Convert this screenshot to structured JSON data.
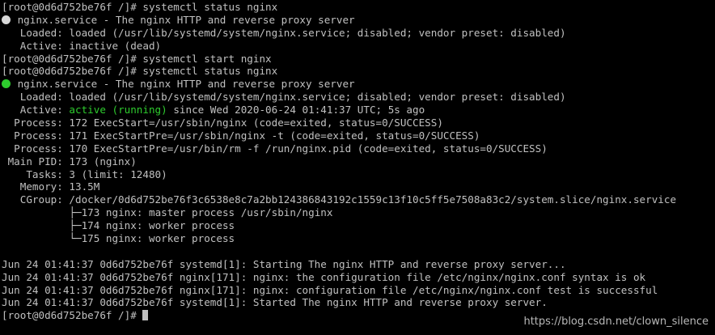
{
  "colors": {
    "background": "#000000",
    "text": "#c0c0c0",
    "active_green": "#2ecc2e",
    "inactive_dot": "#d8d8d8"
  },
  "lines": {
    "l0": "[root@0d6d752be76f /]# systemctl status nginx",
    "l1": "nginx.service - The nginx HTTP and reverse proxy server",
    "l2": "   Loaded: loaded (/usr/lib/systemd/system/nginx.service; disabled; vendor preset: disabled)",
    "l3": "   Active: inactive (dead)",
    "l4": "[root@0d6d752be76f /]# systemctl start nginx",
    "l5": "[root@0d6d752be76f /]# systemctl status nginx",
    "l6": "nginx.service - The nginx HTTP and reverse proxy server",
    "l7": "   Loaded: loaded (/usr/lib/systemd/system/nginx.service; disabled; vendor preset: disabled)",
    "l8_prefix": "   Active: ",
    "l8_status": "active (running)",
    "l8_suffix": " since Wed 2020-06-24 01:41:37 UTC; 5s ago",
    "l9": "  Process: 172 ExecStart=/usr/sbin/nginx (code=exited, status=0/SUCCESS)",
    "l10": "  Process: 171 ExecStartPre=/usr/sbin/nginx -t (code=exited, status=0/SUCCESS)",
    "l11": "  Process: 170 ExecStartPre=/usr/bin/rm -f /run/nginx.pid (code=exited, status=0/SUCCESS)",
    "l12": " Main PID: 173 (nginx)",
    "l13": "    Tasks: 3 (limit: 12480)",
    "l14": "   Memory: 13.5M",
    "l15": "   CGroup: /docker/0d6d752be76f3c6538e8c7a2bb124386843192c1559c13f10c5ff5e7508a83c2/system.slice/nginx.service",
    "l16_branch": "           ├─",
    "l16_text": "173 nginx: master process /usr/sbin/nginx",
    "l17_branch": "           ├─",
    "l17_text": "174 nginx: worker process",
    "l18_branch": "           └─",
    "l18_text": "175 nginx: worker process",
    "l19": "",
    "l20": "Jun 24 01:41:37 0d6d752be76f systemd[1]: Starting The nginx HTTP and reverse proxy server...",
    "l21": "Jun 24 01:41:37 0d6d752be76f nginx[171]: nginx: the configuration file /etc/nginx/nginx.conf syntax is ok",
    "l22": "Jun 24 01:41:37 0d6d752be76f nginx[171]: nginx: configuration file /etc/nginx/nginx.conf test is successful",
    "l23": "Jun 24 01:41:37 0d6d752be76f systemd[1]: Started The nginx HTTP and reverse proxy server.",
    "l24": "[root@0d6d752be76f /]# "
  },
  "watermark": "https://blog.csdn.net/clown_silence"
}
